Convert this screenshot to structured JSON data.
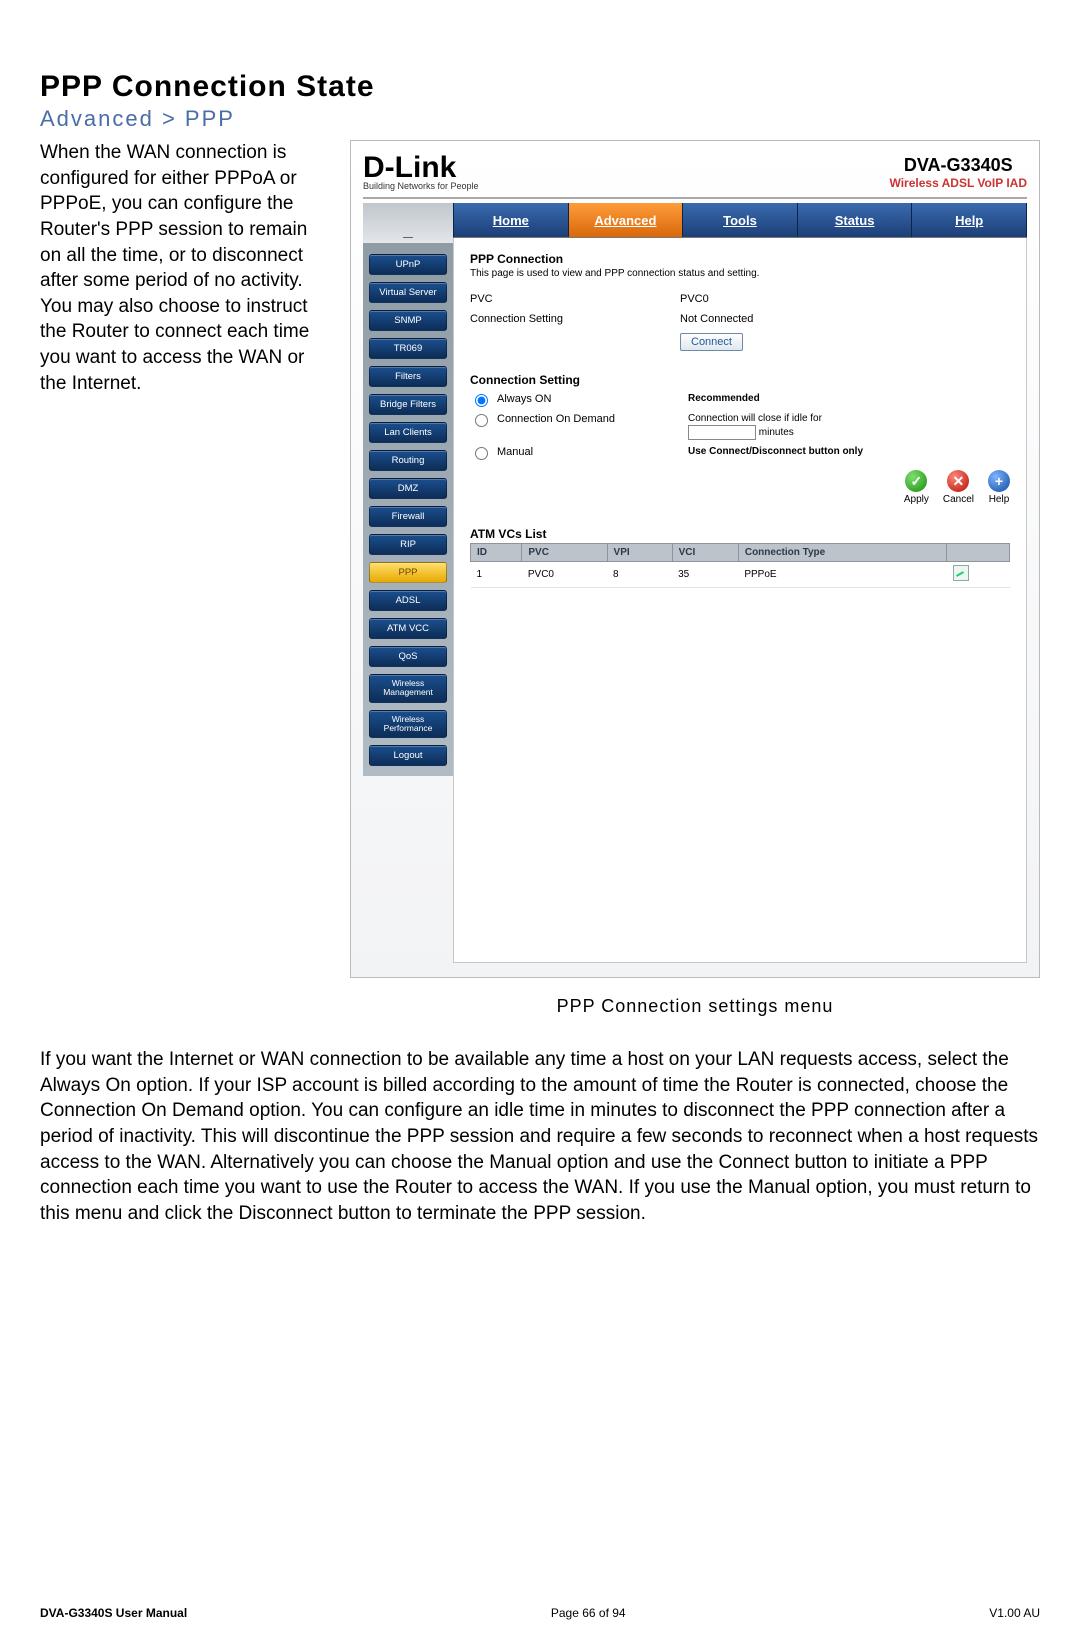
{
  "doc": {
    "title": "PPP Connection State",
    "breadcrumb": "Advanced > PPP",
    "intro": "When the WAN connection is configured for either PPPoA or PPPoE, you can configure the Router's PPP session to remain on all the time, or to disconnect after some period of no activity. You may also choose to instruct the Router to connect each time you want to access the WAN or the Internet.",
    "caption": "PPP Connection settings menu",
    "body_1": "If you want the Internet or WAN connection to be available any time a host on your LAN requests access, select the ",
    "body_always": "Always On",
    "body_2": " option. If your ISP account is billed according to the amount of time the Router is connected, choose the ",
    "body_cod": "Connection On Demand",
    "body_3": " option. You can configure an idle time in minutes to disconnect the PPP connection after a period of inactivity. This will discontinue the PPP session and require a few seconds to reconnect when a host requests access to the WAN. Alternatively you can choose the ",
    "body_manual": "Manual",
    "body_4": " option and use the ",
    "body_connect": "Connect",
    "body_5": " button to initiate a PPP connection each time you want to use the Router to access the WAN. If you use the Manual option, you must return to this menu and click the ",
    "body_disconnect": "Disconnect",
    "body_6": " button to terminate the PPP session."
  },
  "router": {
    "brand": "D-Link",
    "brand_tag": "Building Networks for People",
    "model": "DVA-G3340S",
    "model_sub": "Wireless ADSL VoIP IAD",
    "tabs": {
      "home": "Home",
      "advanced": "Advanced",
      "tools": "Tools",
      "status": "Status",
      "help": "Help"
    },
    "sidebar": {
      "items": [
        {
          "label": "UPnP"
        },
        {
          "label": "Virtual Server"
        },
        {
          "label": "SNMP"
        },
        {
          "label": "TR069"
        },
        {
          "label": "Filters"
        },
        {
          "label": "Bridge Filters"
        },
        {
          "label": "Lan Clients"
        },
        {
          "label": "Routing"
        },
        {
          "label": "DMZ"
        },
        {
          "label": "Firewall"
        },
        {
          "label": "RIP"
        },
        {
          "label": "PPP"
        },
        {
          "label": "ADSL"
        },
        {
          "label": "ATM VCC"
        },
        {
          "label": "QoS"
        },
        {
          "label": "Wireless Management"
        },
        {
          "label": "Wireless Performance"
        },
        {
          "label": "Logout"
        }
      ]
    },
    "panel": {
      "heading": "PPP Connection",
      "desc": "This page is used to view and PPP connection status and setting.",
      "pvc_label": "PVC",
      "pvc_value": "PVC0",
      "conn_label": "Connection Setting",
      "conn_value": "Not Connected",
      "connect_btn": "Connect",
      "sect2": "Connection Setting",
      "opt_always": "Always ON",
      "opt_always_note": "Recommended",
      "opt_demand": "Connection On Demand",
      "opt_demand_note_1": "Connection will close if idle for",
      "opt_demand_note_2": "minutes",
      "opt_manual": "Manual",
      "opt_manual_note": "Use Connect/Disconnect button only",
      "actions": {
        "apply": "Apply",
        "cancel": "Cancel",
        "help": "Help"
      },
      "table_title": "ATM VCs List",
      "table_headers": {
        "id": "ID",
        "pvc": "PVC",
        "vpi": "VPI",
        "vci": "VCI",
        "type": "Connection Type",
        "edit": ""
      },
      "table_rows": [
        {
          "id": "1",
          "pvc": "PVC0",
          "vpi": "8",
          "vci": "35",
          "type": "PPPoE"
        }
      ]
    }
  },
  "footer": {
    "left": "DVA-G3340S User Manual",
    "center": "Page 66 of 94",
    "right": "V1.00 AU"
  }
}
